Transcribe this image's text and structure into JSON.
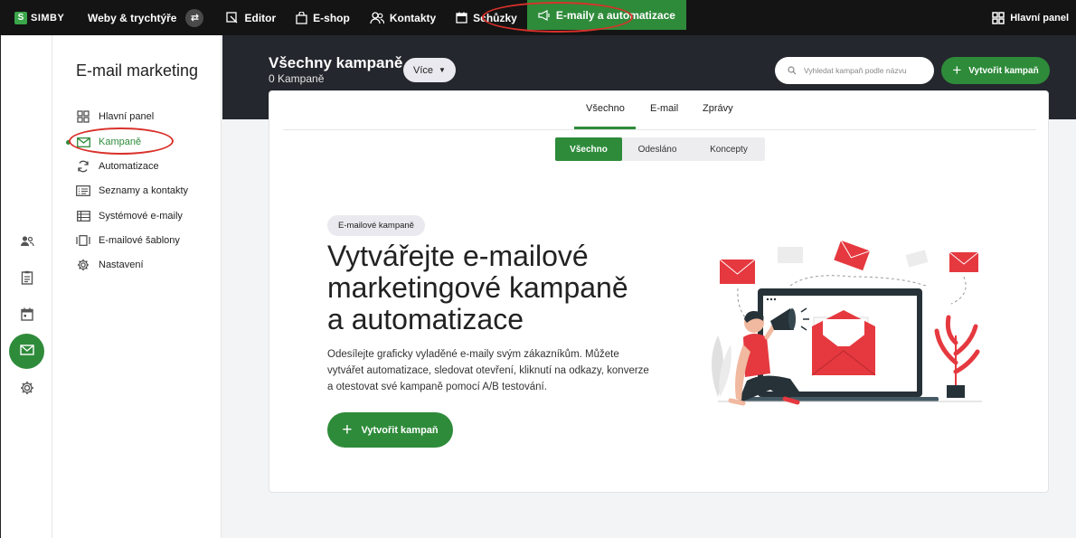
{
  "topbar": {
    "logo": "SIMBY",
    "site_name": "Weby & trychtýře",
    "nav": [
      {
        "label": "Editor",
        "icon": "editor-icon"
      },
      {
        "label": "E-shop",
        "icon": "shop-bag-icon"
      },
      {
        "label": "Kontakty",
        "icon": "contacts-icon"
      },
      {
        "label": "Schůzky",
        "icon": "calendar-icon"
      },
      {
        "label": "E-maily a automatizace",
        "icon": "megaphone-icon",
        "active": true
      }
    ],
    "dashboard_label": "Hlavní panel"
  },
  "sidebar": {
    "title": "E-mail marketing",
    "items": [
      {
        "label": "Hlavní panel",
        "icon": "dashboard-icon"
      },
      {
        "label": "Kampaně",
        "icon": "mail-icon",
        "active": true
      },
      {
        "label": "Automatizace",
        "icon": "refresh-icon"
      },
      {
        "label": "Seznamy a kontakty",
        "icon": "list-icon"
      },
      {
        "label": "Systémové e-maily",
        "icon": "table-icon"
      },
      {
        "label": "E-mailové šablony",
        "icon": "template-icon"
      },
      {
        "label": "Nastavení",
        "icon": "gear-icon"
      }
    ]
  },
  "header": {
    "title": "Všechny kampaně",
    "subtitle": "0 Kampaně",
    "more_label": "Více",
    "search_placeholder": "Vyhledat kampaň podle názvu",
    "create_label": "Vytvořit kampaň"
  },
  "tabs": [
    "Všechno",
    "E-mail",
    "Zprávy"
  ],
  "filters": [
    "Všechno",
    "Odesláno",
    "Koncepty"
  ],
  "hero": {
    "badge": "E-mailové kampaně",
    "title_lines": [
      "Vytvářejte e-mailové",
      "marketingové kampaně",
      "a automatizace"
    ],
    "description_lines": [
      "Odesílejte graficky vyladěné e-maily svým zákazníkům. Můžete",
      "vytvářet automatizace, sledovat otevření, kliknutí na odkazy, konverze",
      "a otestovat své kampaně pomocí A/B testování."
    ],
    "create_label": "Vytvořit kampaň"
  },
  "colors": {
    "accent": "#2e8b3a",
    "topbar": "#141414",
    "header_band": "#24272d",
    "highlight_oval": "#d9312a",
    "illustration_red": "#e5393f"
  }
}
